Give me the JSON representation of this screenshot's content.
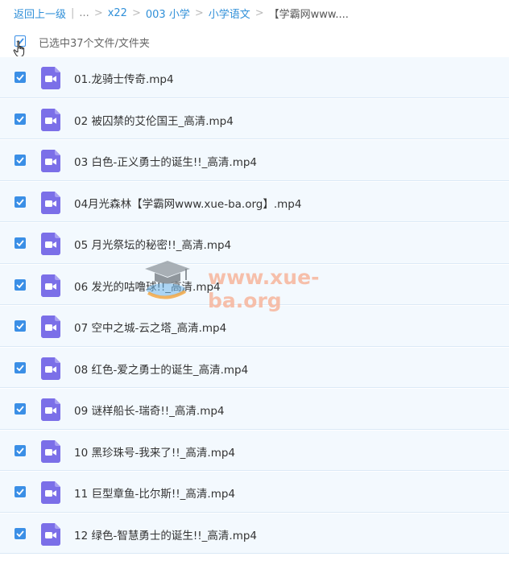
{
  "breadcrumb": {
    "back": "返回上一级",
    "ellipsis": "...",
    "items": [
      "x22",
      "003 小学",
      "小学语文"
    ],
    "current": "【学霸网www...."
  },
  "selection": {
    "text": "已选中37个文件/文件夹"
  },
  "files": [
    {
      "name": "01.龙骑士传奇.mp4"
    },
    {
      "name": "02 被囚禁的艾伦国王_高清.mp4"
    },
    {
      "name": "03 白色-正义勇士的诞生!!_高清.mp4"
    },
    {
      "name": "04月光森林【学霸网www.xue-ba.org】.mp4"
    },
    {
      "name": "05 月光祭坛的秘密!!_高清.mp4"
    },
    {
      "name": "06 发光的咕噜球!!_高清.mp4"
    },
    {
      "name": "07 空中之城-云之塔_高清.mp4"
    },
    {
      "name": "08 红色-爱之勇士的诞生_高清.mp4"
    },
    {
      "name": "09 谜样船长-瑞奇!!_高清.mp4"
    },
    {
      "name": "10 黑珍珠号-我来了!!_高清.mp4"
    },
    {
      "name": "11 巨型章鱼-比尔斯!!_高清.mp4"
    },
    {
      "name": "12 绿色-智慧勇士的诞生!!_高清.mp4"
    }
  ],
  "watermark": {
    "text": "www.xue-ba.org"
  },
  "colors": {
    "link": "#2f8fd8",
    "checkbox": "#3b8fe6",
    "video_icon": "#7b6fe8",
    "row_bg": "#f3f9fe"
  },
  "icons": {
    "file": "video-file-icon",
    "check": "checkmark-icon",
    "cursor": "hand-pointer-icon"
  }
}
